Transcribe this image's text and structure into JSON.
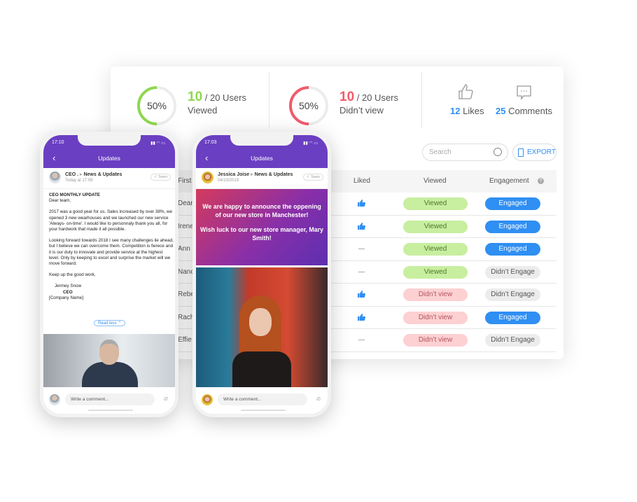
{
  "stats": {
    "viewed": {
      "percent_label": "50%",
      "percent": 50,
      "count": "10",
      "total": "/ 20 Users",
      "label": "Viewed",
      "color": "#8ed84e"
    },
    "not_viewed": {
      "percent_label": "50%",
      "percent": 50,
      "count": "10",
      "total": "/ 20 Users",
      "label": "Didn’t view",
      "color": "#f25a6a"
    },
    "likes": {
      "count": "12",
      "label": "Likes",
      "icon": "thumbs-up-icon"
    },
    "comments": {
      "count": "25",
      "label": "Comments",
      "icon": "comment-icon"
    }
  },
  "toolbar": {
    "search_placeholder": "Search",
    "export_label": "EXPORT"
  },
  "table": {
    "headers": {
      "first": "First",
      "liked": "Liked",
      "viewed": "Viewed",
      "engagement": "Engagement"
    },
    "rows": [
      {
        "name": "Dean",
        "liked": true,
        "viewed": "Viewed",
        "engagement": "Engaged"
      },
      {
        "name": "Irene",
        "liked": true,
        "viewed": "Viewed",
        "engagement": "Engaged"
      },
      {
        "name": "Ann",
        "liked": false,
        "viewed": "Viewed",
        "engagement": "Engaged"
      },
      {
        "name": "Nanc",
        "liked": false,
        "viewed": "Viewed",
        "engagement": "Didn’t Engage"
      },
      {
        "name": "Rebe",
        "liked": true,
        "viewed": "Didn’t view",
        "engagement": "Didn’t Engage"
      },
      {
        "name": "Rache",
        "liked": true,
        "viewed": "Didn’t view",
        "engagement": "Engaged"
      },
      {
        "name": "Effie",
        "liked": false,
        "viewed": "Didn’t view",
        "engagement": "Didn’t Engage"
      }
    ]
  },
  "phone1": {
    "time": "17:10",
    "title": "Updates",
    "author": "CEO .",
    "channel": "News & Updates",
    "date": "Today at 17:09",
    "seen": "✓ Seen",
    "heading": "CEO MONTHLY UPDATE",
    "greeting": "Dear team,",
    "p1": "2017 was a good year for us. Sales increased by over 38%, we opened 3 new wearhouses and we launched our new service 'Always- on-time'. I would like to personnaly thank you all, for your hardwork that made it all possible.",
    "p2": "Looking forward towards 2018 I see many challenges lie ahead, but I believe we can overcome them. Competition is fierece and it is our duty to innovate and provide service at the highest level. Only by keeping to excel and surprise the market will we move forward.",
    "p3": "Keep up the good work,",
    "sig_name": "Jermey Snow",
    "sig_role": "CEO",
    "sig_company": "[Company Name]",
    "read_less": "Read less ⌃",
    "comment_placeholder": "Write a comment..."
  },
  "phone2": {
    "time": "17:03",
    "title": "Updates",
    "author": "Jessica Joise",
    "channel": "News & Updates",
    "date": "04/10/2019",
    "seen": "✓ Seen",
    "banner_line1": "We are happy to announce the oppening of our new store in Manchester!",
    "banner_line2": "Wish luck to our new store manager, Mary Smith!",
    "comment_placeholder": "Write a comment..."
  }
}
